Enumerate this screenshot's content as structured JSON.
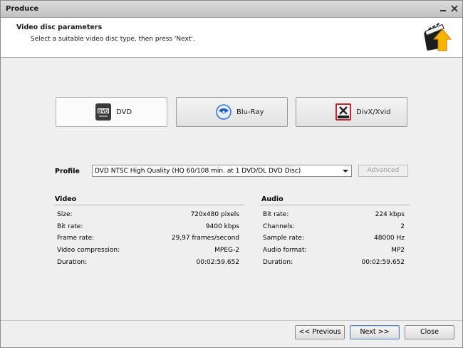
{
  "window": {
    "title": "Produce"
  },
  "header": {
    "title": "Video disc parameters",
    "subtitle": "Select a suitable video disc type, then press 'Next'."
  },
  "disc_types": [
    {
      "label": "DVD",
      "selected": true
    },
    {
      "label": "Blu-Ray",
      "selected": false
    },
    {
      "label": "DivX/Xvid",
      "selected": false
    }
  ],
  "profile": {
    "label": "Profile",
    "value": "DVD NTSC High Quality (HQ 60/108 min. at 1 DVD/DL DVD Disc)",
    "advanced_label": "Advanced"
  },
  "video": {
    "title": "Video",
    "rows": [
      {
        "key": "Size:",
        "value": "720x480 pixels"
      },
      {
        "key": "Bit rate:",
        "value": "9400 kbps"
      },
      {
        "key": "Frame rate:",
        "value": "29,97 frames/second"
      },
      {
        "key": "Video compression:",
        "value": "MPEG-2"
      },
      {
        "key": "Duration:",
        "value": "00:02:59.652"
      }
    ]
  },
  "audio": {
    "title": "Audio",
    "rows": [
      {
        "key": "Bit rate:",
        "value": "224 kbps"
      },
      {
        "key": "Channels:",
        "value": "2"
      },
      {
        "key": "Sample rate:",
        "value": "48000 Hz"
      },
      {
        "key": "Audio format:",
        "value": "MP2"
      },
      {
        "key": "Duration:",
        "value": "00:02:59.652"
      }
    ]
  },
  "footer": {
    "prev_label": "<< Previous",
    "next_label": "Next >>",
    "close_label": "Close"
  },
  "colors": {
    "titlebar": "#c8c8c8",
    "accent_blue": "#2f6fd6",
    "logo_orange": "#f2a000"
  }
}
